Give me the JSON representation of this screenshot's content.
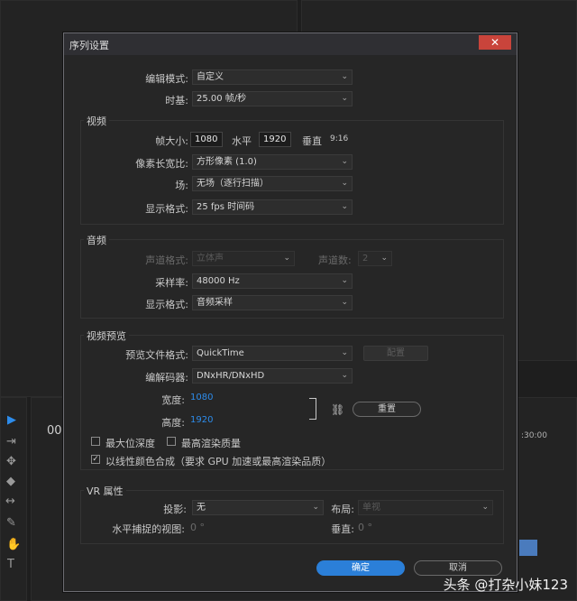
{
  "dialog": {
    "title": "序列设置",
    "close_icon": "close-icon"
  },
  "general": {
    "edit_mode_label": "编辑模式:",
    "edit_mode_value": "自定义",
    "timebase_label": "时基:",
    "timebase_value": "25.00  帧/秒"
  },
  "video": {
    "section_title": "视频",
    "frame_size_label": "帧大小:",
    "frame_width": "1080",
    "horizontal_label": "水平",
    "frame_height": "1920",
    "vertical_label": "垂直",
    "aspect": "9:16",
    "pixel_aspect_label": "像素长宽比:",
    "pixel_aspect_value": "方形像素 (1.0)",
    "field_label": "场:",
    "field_value": "无场（逐行扫描）",
    "display_format_label": "显示格式:",
    "display_format_value": "25 fps 时间码"
  },
  "audio": {
    "section_title": "音频",
    "channel_format_label": "声道格式:",
    "channel_format_value": "立体声",
    "channels_label": "声道数:",
    "channels_value": "2",
    "sample_rate_label": "采样率:",
    "sample_rate_value": "48000 Hz",
    "display_format_label": "显示格式:",
    "display_format_value": "音频采样"
  },
  "preview": {
    "section_title": "视频预览",
    "file_format_label": "预览文件格式:",
    "file_format_value": "QuickTime",
    "configure_button": "配置",
    "codec_label": "编解码器:",
    "codec_value": "DNxHR/DNxHD",
    "width_label": "宽度:",
    "width_value": "1080",
    "height_label": "高度:",
    "height_value": "1920",
    "reset_button": "重置",
    "max_bit_depth_label": "最大位深度",
    "max_render_quality_label": "最高渲染质量",
    "linear_color_label": "以线性颜色合成（要求 GPU 加速或最高渲染品质）"
  },
  "vr": {
    "section_title": "VR 属性",
    "projection_label": "投影:",
    "projection_value": "无",
    "layout_label": "布局:",
    "layout_value": "单视",
    "h_fov_label": "水平捕捉的视图:",
    "h_fov_value": "0 °",
    "v_fov_label": "垂直:",
    "v_fov_value": "0 °"
  },
  "footer": {
    "ok_button": "确定",
    "cancel_button": "取消"
  },
  "background": {
    "timecode": "00",
    "timeline_time": ":30:00"
  },
  "watermark": "头条 @打杂小妹123"
}
